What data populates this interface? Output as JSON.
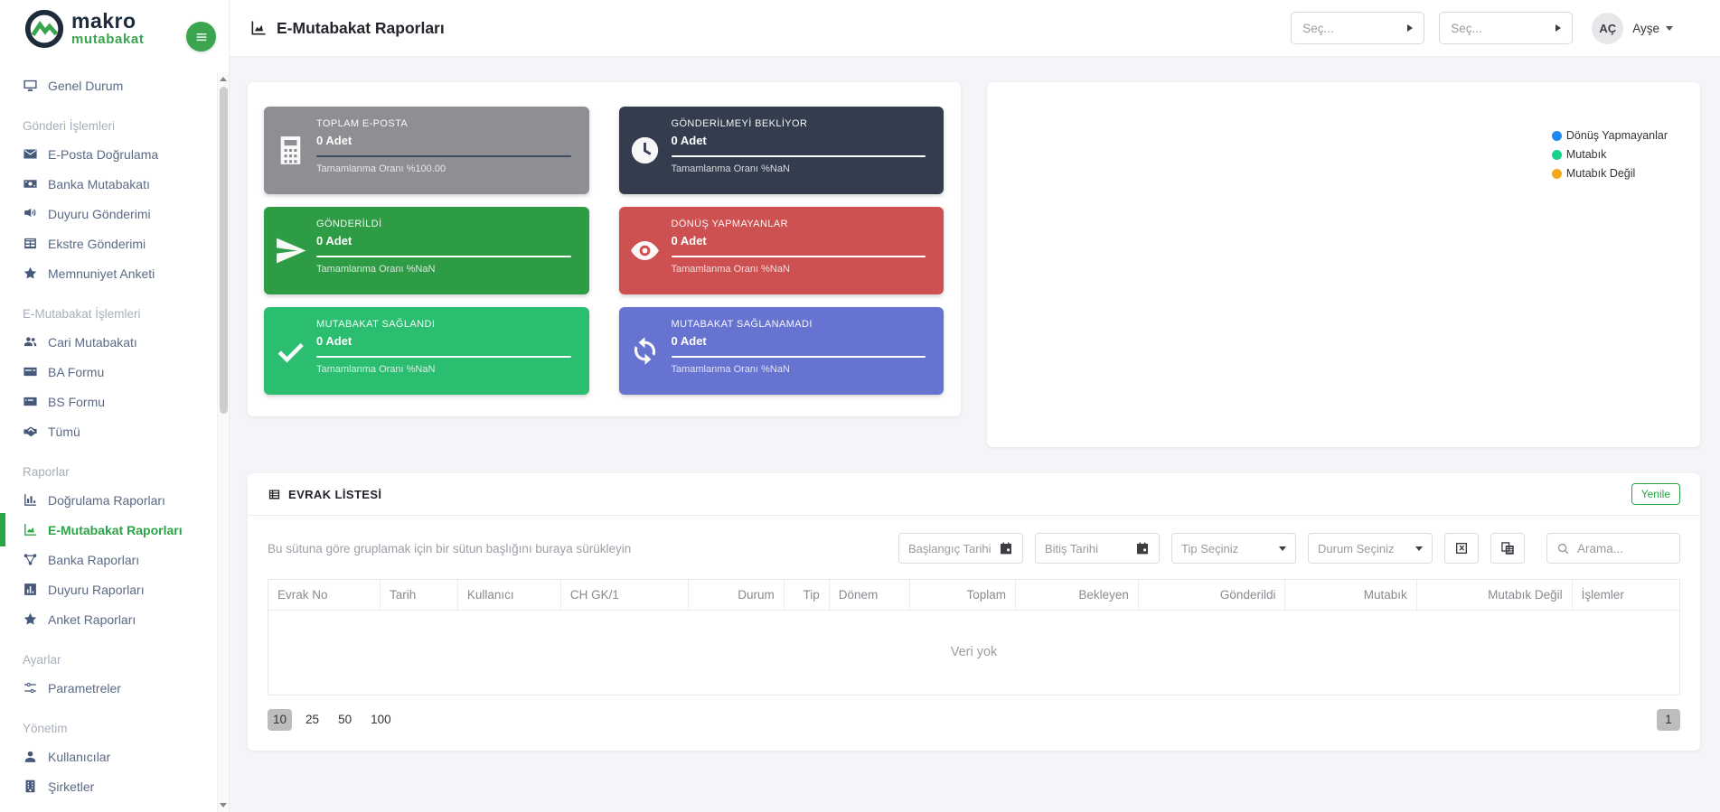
{
  "brand": {
    "logo_top": "makro",
    "logo_bottom": "mutabakat",
    "green": "#3aa44e",
    "navy": "#1d2b3a"
  },
  "sidebar": {
    "sections": [
      {
        "label": "",
        "items": [
          {
            "id": "genel-durum",
            "label": "Genel Durum",
            "icon": "monitor-icon"
          }
        ]
      },
      {
        "label": "Gönderi İşlemleri",
        "items": [
          {
            "id": "e-posta-dogrulama",
            "label": "E-Posta Doğrulama",
            "icon": "mail-icon"
          },
          {
            "id": "banka-mutabakati",
            "label": "Banka Mutabakatı",
            "icon": "banknote-icon"
          },
          {
            "id": "duyuru-gonderimi",
            "label": "Duyuru Gönderimi",
            "icon": "megaphone-icon"
          },
          {
            "id": "ekstre-gonderimi",
            "label": "Ekstre Gönderimi",
            "icon": "table-icon"
          },
          {
            "id": "memnuniyet-anketi",
            "label": "Memnuniyet Anketi",
            "icon": "star-icon"
          }
        ]
      },
      {
        "label": "E-Mutabakat İşlemleri",
        "items": [
          {
            "id": "cari-mutabakati",
            "label": "Cari Mutabakatı",
            "icon": "users-icon"
          },
          {
            "id": "ba-formu",
            "label": "BA Formu",
            "icon": "card-icon"
          },
          {
            "id": "bs-formu",
            "label": "BS Formu",
            "icon": "card-dollar-icon"
          },
          {
            "id": "tumu",
            "label": "Tümü",
            "icon": "handshake-icon"
          }
        ]
      },
      {
        "label": "Raporlar",
        "items": [
          {
            "id": "dogrulama-raporlari",
            "label": "Doğrulama Raporları",
            "icon": "bar-chart-icon"
          },
          {
            "id": "e-mutabakat-raporlari",
            "label": "E-Mutabakat Raporları",
            "icon": "area-chart-icon",
            "active": true
          },
          {
            "id": "banka-raporlari",
            "label": "Banka Raporları",
            "icon": "network-icon"
          },
          {
            "id": "duyuru-raporlari",
            "label": "Duyuru Raporları",
            "icon": "chart-box-icon"
          },
          {
            "id": "anket-raporlari",
            "label": "Anket Raporları",
            "icon": "star-icon"
          }
        ]
      },
      {
        "label": "Ayarlar",
        "items": [
          {
            "id": "parametreler",
            "label": "Parametreler",
            "icon": "sliders-icon"
          }
        ]
      },
      {
        "label": "Yönetim",
        "items": [
          {
            "id": "kullanicilar",
            "label": "Kullanıcılar",
            "icon": "user-icon"
          },
          {
            "id": "sirketler",
            "label": "Şirketler",
            "icon": "building-icon"
          }
        ]
      }
    ]
  },
  "header": {
    "title": "E-Mutabakat Raporları",
    "select_left_placeholder": "Seç...",
    "select_right_placeholder": "Seç...",
    "avatar_initials": "AÇ",
    "user_name": "Ayşe"
  },
  "cards": [
    {
      "id": "toplam-eposta",
      "title": "TOPLAM E-POSTA",
      "count": "0 Adet",
      "footer": "Tamamlanma Oranı %100.00",
      "bg": "#8e8e93",
      "divider": "#3e4c5f",
      "icon": "calculator-icon"
    },
    {
      "id": "gonderilmeyi-bekliyor",
      "title": "GÖNDERİLMEYİ BEKLİYOR",
      "count": "0 Adet",
      "footer": "Tamamlanma Oranı %NaN",
      "bg": "#333d4e",
      "divider": "#ffffff",
      "icon": "clock-icon"
    },
    {
      "id": "gonderildi",
      "title": "GÖNDERİLDİ",
      "count": "0 Adet",
      "footer": "Tamamlanma Oranı %NaN",
      "bg": "#2e9c45",
      "divider": "#ffffff",
      "icon": "send-icon"
    },
    {
      "id": "donus-yapmayanlar",
      "title": "DÖNÜŞ YAPMAYANLAR",
      "count": "0 Adet",
      "footer": "Tamamlanma Oranı %NaN",
      "bg": "#cd5151",
      "divider": "#ffffff",
      "icon": "eye-icon"
    },
    {
      "id": "mutabakat-saglandi",
      "title": "MUTABAKAT SAĞLANDI",
      "count": "0 Adet",
      "footer": "Tamamlanma Oranı %NaN",
      "bg": "#2bbd70",
      "divider": "#ffffff",
      "icon": "check-icon"
    },
    {
      "id": "mutabakat-saglanamadi",
      "title": "MUTABAKAT SAĞLANAMADI",
      "count": "0 Adet",
      "footer": "Tamamlanma Oranı %NaN",
      "bg": "#6673d0",
      "divider": "#ffffff",
      "icon": "sync-icon"
    }
  ],
  "chart_panel": {
    "legend": [
      {
        "label": "Dönüş Yapmayanlar",
        "color": "#1e88f5"
      },
      {
        "label": "Mutabık",
        "color": "#15d18b"
      },
      {
        "label": "Mutabık Değil",
        "color": "#f5a81c"
      }
    ]
  },
  "evrak": {
    "title": "EVRAK LİSTESİ",
    "refresh_label": "Yenile",
    "group_hint": "Bu sütuna göre gruplamak için bir sütun başlığını buraya sürükleyin",
    "filters": {
      "start_date_placeholder": "Başlangıç Tarihi",
      "end_date_placeholder": "Bitiş Tarihi",
      "type_placeholder": "Tip Seçiniz",
      "status_placeholder": "Durum Seçiniz",
      "search_placeholder": "Arama..."
    },
    "columns": [
      "Evrak No",
      "Tarih",
      "Kullanıcı",
      "CH GK/1",
      "Durum",
      "Tip",
      "Dönem",
      "Toplam",
      "Bekleyen",
      "Gönderildi",
      "Mutabık",
      "Mutabık Değil",
      "İşlemler"
    ],
    "empty_text": "Veri yok",
    "pager": {
      "sizes": [
        "10",
        "25",
        "50",
        "100"
      ],
      "active_size": "10",
      "current_page": "1"
    }
  }
}
